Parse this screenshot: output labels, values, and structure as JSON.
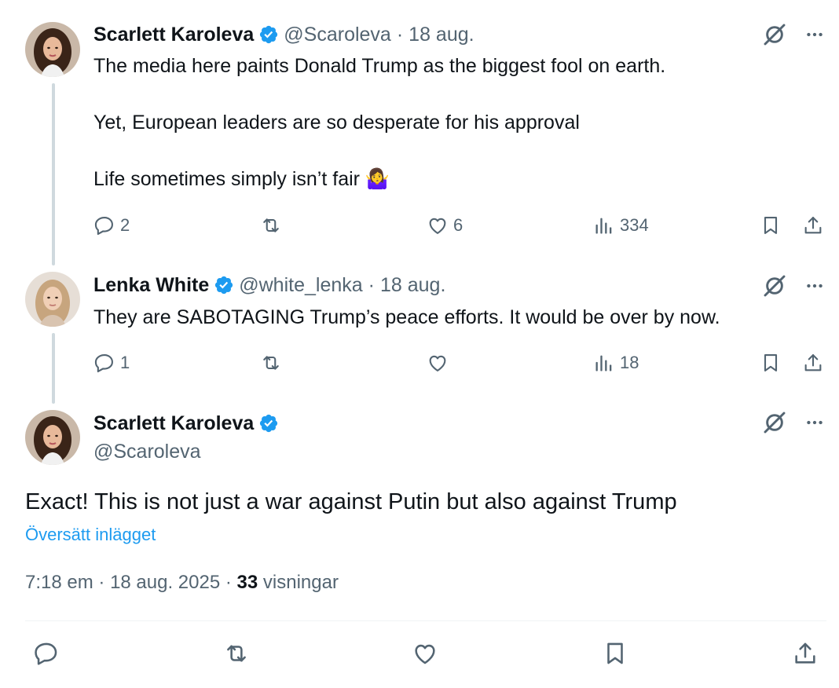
{
  "tweets": [
    {
      "display_name": "Scarlett Karoleva",
      "handle": "@Scaroleva",
      "separator": "·",
      "date": "18 aug.",
      "text": "The media here paints Donald Trump as the biggest fool on earth.\n\nYet, European leaders are so desperate for his approval\n\nLife sometimes simply isn’t fair 🤷‍♀️",
      "replies": "2",
      "reposts": "",
      "likes": "6",
      "views": "334"
    },
    {
      "display_name": "Lenka White",
      "handle": "@white_lenka",
      "separator": "·",
      "date": "18 aug.",
      "text": "They are SABOTAGING Trump’s peace efforts. It would be over by now.",
      "replies": "1",
      "reposts": "",
      "likes": "",
      "views": "18"
    }
  ],
  "main_tweet": {
    "display_name": "Scarlett Karoleva",
    "handle": "@Scaroleva",
    "text": "Exact! This is not just a war against Putin but also against Trump",
    "translate_label": "Översätt inlägget",
    "time": "7:18 em",
    "separator": "·",
    "date": "18 aug. 2025",
    "views_count": "33",
    "views_label": "visningar"
  },
  "icons": {
    "reply": "reply-icon",
    "repost": "repost-icon",
    "like": "like-icon",
    "views": "views-icon",
    "bookmark": "bookmark-icon",
    "share": "share-icon",
    "grok": "grok-icon",
    "more": "more-icon",
    "verified": "verified-badge-icon"
  },
  "colors": {
    "text": "#0f1419",
    "secondary": "#536471",
    "accent": "#1d9bf0",
    "thread_line": "#cfd9de"
  }
}
